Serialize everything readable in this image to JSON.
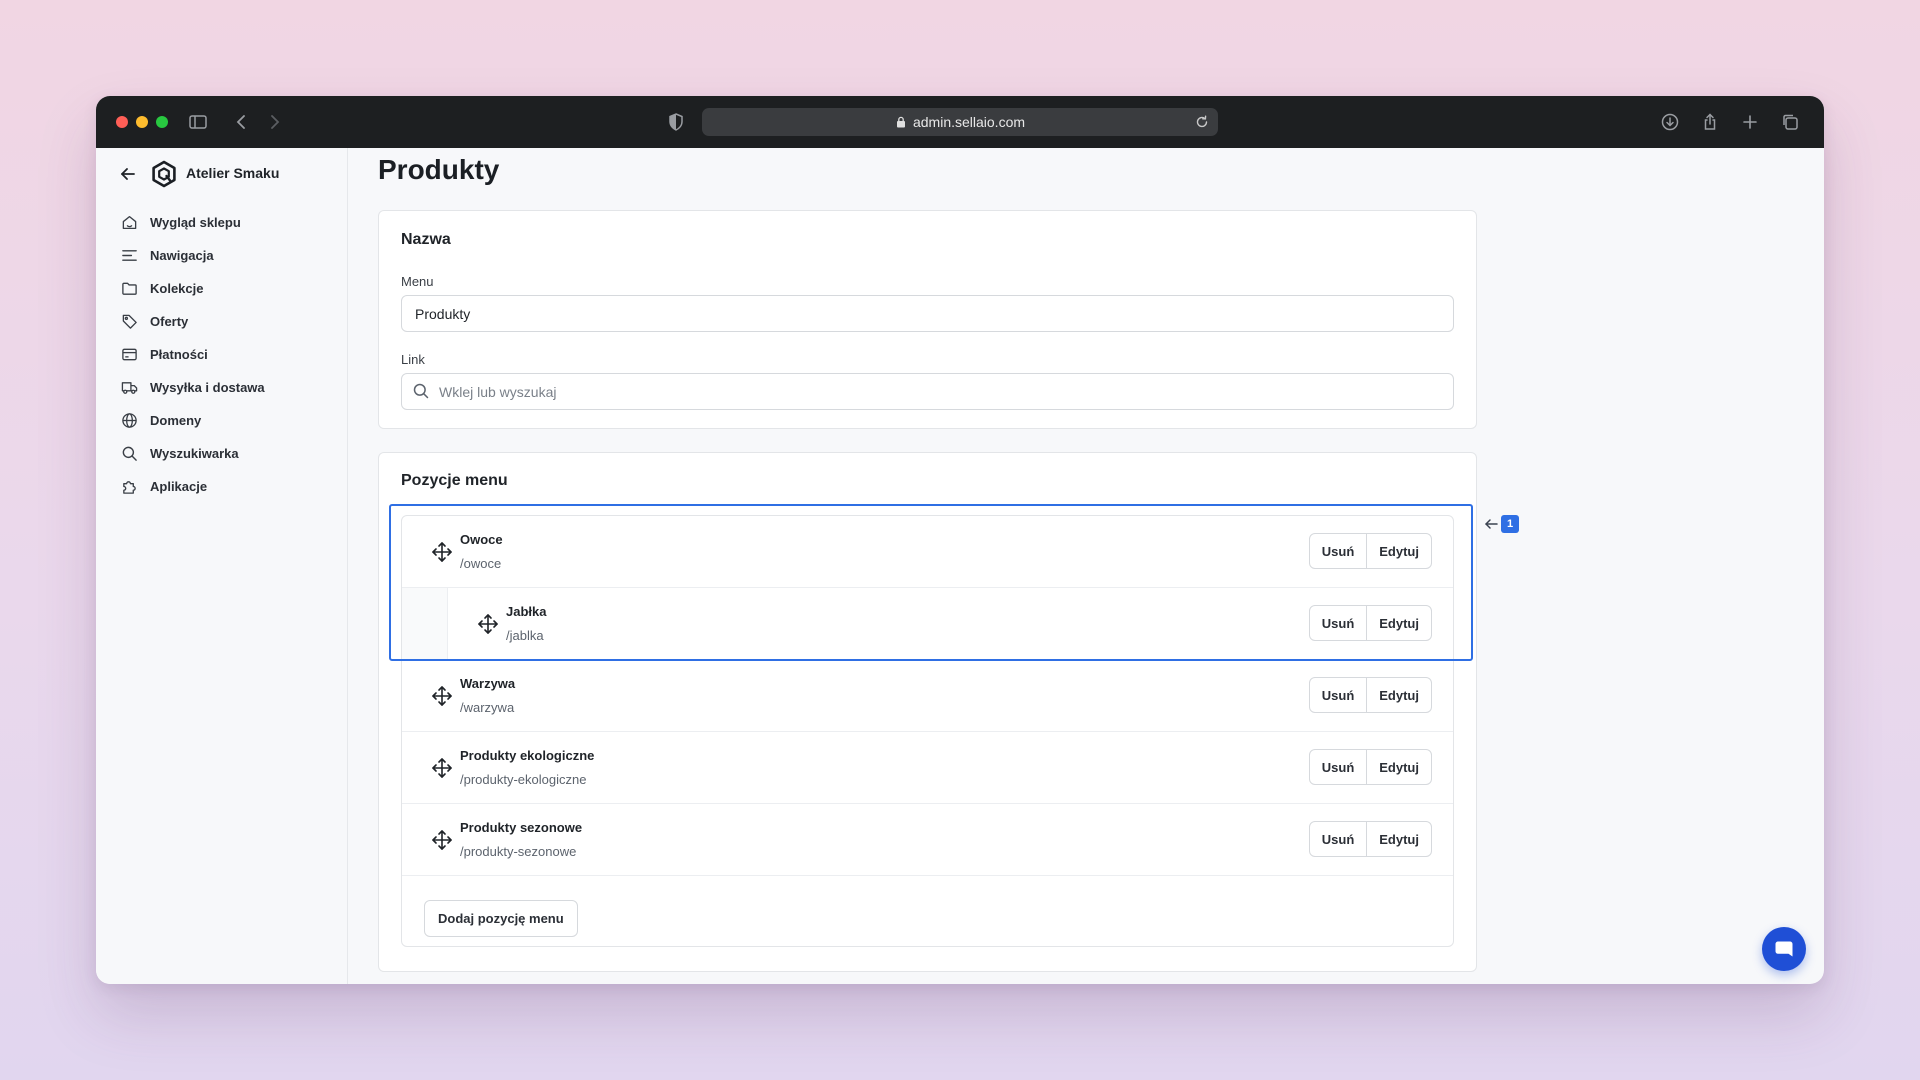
{
  "browser": {
    "url": "admin.sellaio.com"
  },
  "sidebar": {
    "store_name": "Atelier Smaku",
    "items": [
      {
        "label": "Wygląd sklepu",
        "icon": "home-icon"
      },
      {
        "label": "Nawigacja",
        "icon": "menu-lines-icon"
      },
      {
        "label": "Kolekcje",
        "icon": "folder-icon"
      },
      {
        "label": "Oferty",
        "icon": "tag-icon"
      },
      {
        "label": "Płatności",
        "icon": "credit-card-icon"
      },
      {
        "label": "Wysyłka i dostawa",
        "icon": "truck-icon"
      },
      {
        "label": "Domeny",
        "icon": "globe-icon"
      },
      {
        "label": "Wyszukiwarka",
        "icon": "search-icon"
      },
      {
        "label": "Aplikacje",
        "icon": "puzzle-icon"
      }
    ]
  },
  "main": {
    "title": "Produkty",
    "name_card": {
      "title": "Nazwa",
      "menu_label": "Menu",
      "menu_value": "Produkty",
      "link_label": "Link",
      "link_placeholder": "Wklej lub wyszukaj"
    },
    "items_card": {
      "title": "Pozycje menu",
      "remove_label": "Usuń",
      "edit_label": "Edytuj",
      "add_label": "Dodaj pozycję menu",
      "items": [
        {
          "name": "Owoce",
          "path": "/owoce"
        },
        {
          "name": "Jabłka",
          "path": "/jablka",
          "child": true
        },
        {
          "name": "Warzywa",
          "path": "/warzywa"
        },
        {
          "name": "Produkty ekologiczne",
          "path": "/produkty-ekologiczne"
        },
        {
          "name": "Produkty sezonowe",
          "path": "/produkty-sezonowe"
        }
      ]
    }
  },
  "annotation": {
    "badge": "1"
  },
  "colors": {
    "accent": "#2f6fe4",
    "chat_button": "#1f4fd6"
  }
}
